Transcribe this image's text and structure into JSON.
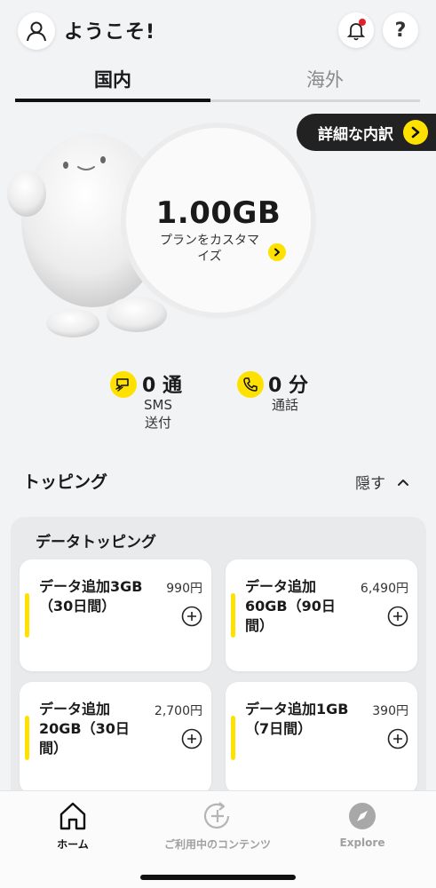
{
  "header": {
    "title": "ようこそ!",
    "help_label": "?"
  },
  "tabs": [
    {
      "label": "国内",
      "active": true
    },
    {
      "label": "海外",
      "active": false
    }
  ],
  "details_button": {
    "label": "詳細な内訳"
  },
  "data_summary": {
    "amount": "1.00GB",
    "plan_link": "プランをカスタマイズ"
  },
  "usage": {
    "sms": {
      "value": "0 通",
      "label_line1": "SMS",
      "label_line2": "送付"
    },
    "calls": {
      "value": "0 分",
      "label": "通話"
    }
  },
  "topping": {
    "title": "トッピング",
    "hide_label": "隠す",
    "section_title": "データトッピング",
    "items": [
      {
        "name_line1": "データ追加3GB",
        "name_line2": "（30日間）",
        "name_line3": "",
        "price": "990円"
      },
      {
        "name_line1": "データ追加",
        "name_line2": "60GB（90日",
        "name_line3": "間）",
        "price": "6,490円"
      },
      {
        "name_line1": "データ追加",
        "name_line2": "20GB（30日",
        "name_line3": "間）",
        "price": "2,700円"
      },
      {
        "name_line1": "データ追加1GB",
        "name_line2": "（7日間）",
        "name_line3": "",
        "price": "390円"
      }
    ]
  },
  "bottom_nav": [
    {
      "label": "ホーム",
      "icon": "home-icon",
      "active": true
    },
    {
      "label": "ご利用中のコンテンツ",
      "icon": "add-refresh-icon",
      "active": false
    },
    {
      "label": "Explore",
      "icon": "compass-icon",
      "active": false
    }
  ],
  "colors": {
    "accent": "#ffe100",
    "notification": "#e0202a",
    "dark": "#222222"
  }
}
